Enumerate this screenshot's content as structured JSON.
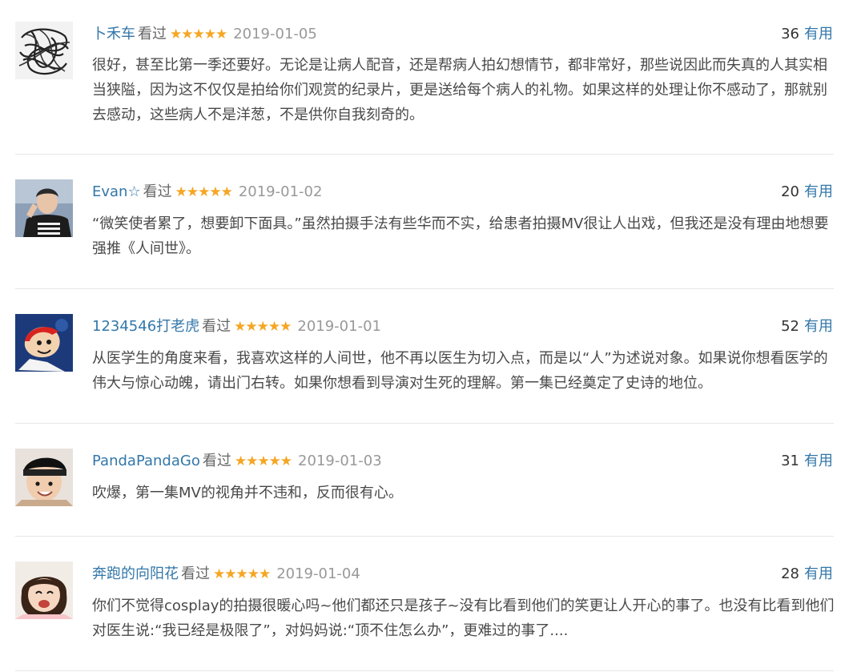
{
  "comments": [
    {
      "author": "卜禾车",
      "status": "看过",
      "stars": "★★★★★",
      "date": "2019-01-05",
      "votes": "36",
      "vote_label": "有用",
      "text": "很好，甚至比第一季还要好。无论是让病人配音，还是帮病人拍幻想情节，都非常好，那些说因此而失真的人其实相当狭隘，因为这不仅仅是拍给你们观赏的纪录片，更是送给每个病人的礼物。如果这样的处理让你不感动了，那就别去感动，这些病人不是洋葱，不是供你自我刻奇的。"
    },
    {
      "author": "Evan☆",
      "status": "看过",
      "stars": "★★★★★",
      "date": "2019-01-02",
      "votes": "20",
      "vote_label": "有用",
      "text": "“微笑使者累了，想要卸下面具。”虽然拍摄手法有些华而不实，给患者拍摄MV很让人出戏，但我还是没有理由地想要强推《人间世》。"
    },
    {
      "author": "1234546打老虎",
      "status": "看过",
      "stars": "★★★★★",
      "date": "2019-01-01",
      "votes": "52",
      "vote_label": "有用",
      "text": "从医学生的角度来看，我喜欢这样的人间世，他不再以医生为切入点，而是以“人”为述说对象。如果说你想看医学的伟大与惊心动魄，请出门右转。如果你想看到导演对生死的理解。第一集已经奠定了史诗的地位。"
    },
    {
      "author": "PandaPandaGo",
      "status": "看过",
      "stars": "★★★★★",
      "date": "2019-01-03",
      "votes": "31",
      "vote_label": "有用",
      "text": "吹爆，第一集MV的视角并不违和，反而很有心。"
    },
    {
      "author": "奔跑的向阳花",
      "status": "看过",
      "stars": "★★★★★",
      "date": "2019-01-04",
      "votes": "28",
      "vote_label": "有用",
      "text": "你们不觉得cosplay的拍摄很暖心吗~他们都还只是孩子~没有比看到他们的笑更让人开心的事了。也没有比看到他们对医生说:“我已经是极限了”，对妈妈说:“顶不住怎么办”，更难过的事了...."
    }
  ],
  "rating": 5,
  "colors": {
    "author_link": "#3377aa",
    "star": "#f5a623",
    "date": "#999999",
    "text": "#494949",
    "divider": "#e6e6e6"
  },
  "icons": [
    "scribble-avatar",
    "boy-avatar",
    "cartoon-avatar",
    "child-avatar",
    "girl-avatar"
  ]
}
